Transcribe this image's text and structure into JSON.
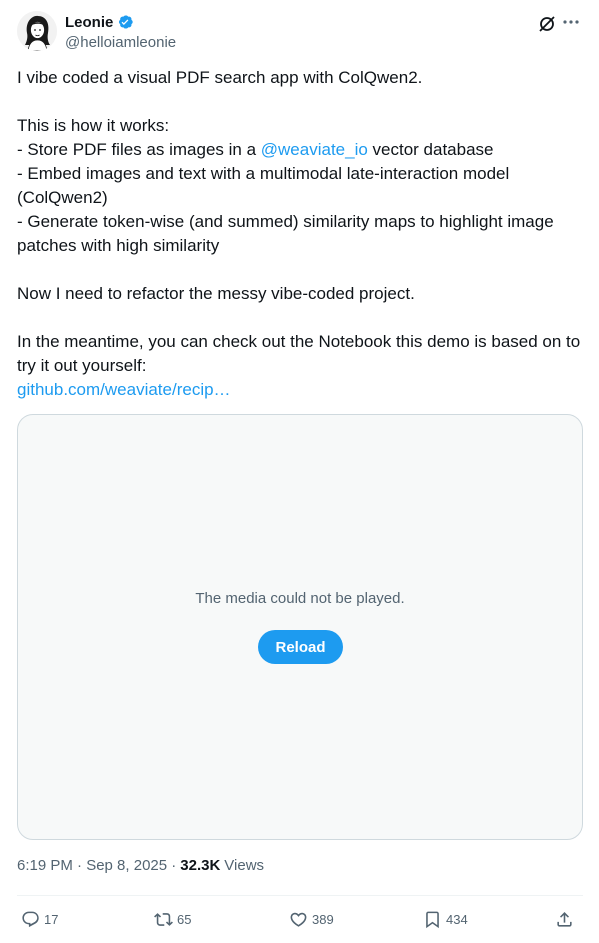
{
  "author": {
    "display_name": "Leonie",
    "handle": "@helloiamleonie",
    "verified": true,
    "avatar_icon": "avatar-illustration"
  },
  "tweet": {
    "line1": "I vibe coded a visual PDF search app with ColQwen2.",
    "line2": "This is how it works:",
    "bullet1_pre": "- Store PDF files as images in a ",
    "bullet1_mention": "@weaviate_io",
    "bullet1_post": " vector database",
    "bullet2": "- Embed images and text with a multimodal late-interaction model (ColQwen2)",
    "bullet3": "- Generate token-wise (and summed) similarity maps to highlight image patches with high similarity",
    "line3": "Now I need to refactor the messy vibe-coded project.",
    "line4": "In the meantime, you can check out the Notebook this demo is based on to try it out yourself:",
    "link": "github.com/weaviate/recip…"
  },
  "media": {
    "message": "The media could not be played.",
    "reload_label": "Reload"
  },
  "meta": {
    "time": "6:19 PM · Sep 8, 2025 ·",
    "views_count": "32.3K",
    "views_label": "Views"
  },
  "actions": {
    "replies": "17",
    "reposts": "65",
    "likes": "389",
    "bookmarks": "434"
  },
  "colors": {
    "accent": "#1d9bf0",
    "text": "#0f1419",
    "secondary": "#536471"
  }
}
